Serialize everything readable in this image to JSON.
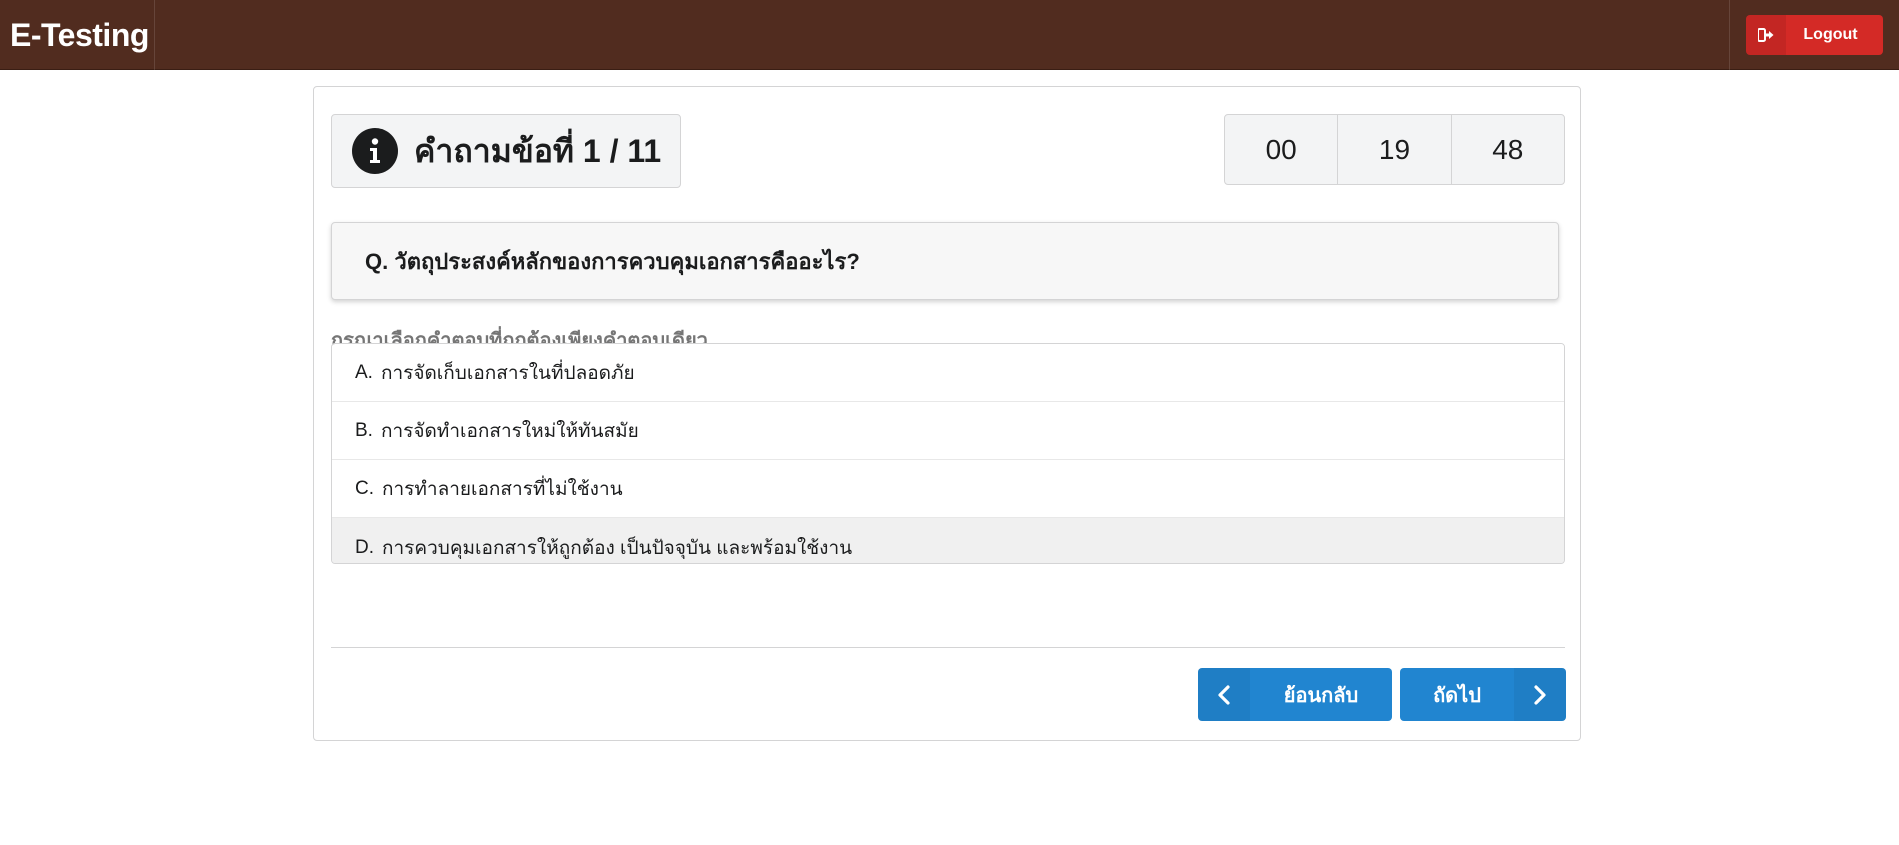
{
  "header": {
    "brand": "E-Testing",
    "logout_label": "Logout"
  },
  "question_header": {
    "label": "คำถามข้อที่ 1 / 11"
  },
  "timer": {
    "hours": "00",
    "minutes": "19",
    "seconds": "48"
  },
  "question": {
    "text": "Q. วัตถุประสงค์หลักของการควบคุมเอกสารคืออะไร?"
  },
  "instruction": "กรุณาเลือกคำตอบที่ถูกต้องเพียงคำตอบเดียว",
  "choices": [
    {
      "letter": "A.",
      "text": "การจัดเก็บเอกสารในที่ปลอดภัย"
    },
    {
      "letter": "B.",
      "text": "การจัดทำเอกสารใหม่ให้ทันสมัย"
    },
    {
      "letter": "C.",
      "text": "การทำลายเอกสารที่ไม่ใช้งาน"
    },
    {
      "letter": "D.",
      "text": "การควบคุมเอกสารให้ถูกต้อง เป็นปัจจุบัน และพร้อมใช้งาน"
    }
  ],
  "nav": {
    "back_label": "ย้อนกลับ",
    "next_label": "ถัดไป"
  },
  "colors": {
    "header_bg": "#512c1f",
    "logout_bg": "#d42a26",
    "primary_button": "#2185d0",
    "hovered_choice_bg": "#f0f0f0"
  },
  "icons": {
    "logout": "sign-out-icon",
    "question_info": "info-circle-icon",
    "back": "chevron-left-icon",
    "next": "chevron-right-icon"
  }
}
